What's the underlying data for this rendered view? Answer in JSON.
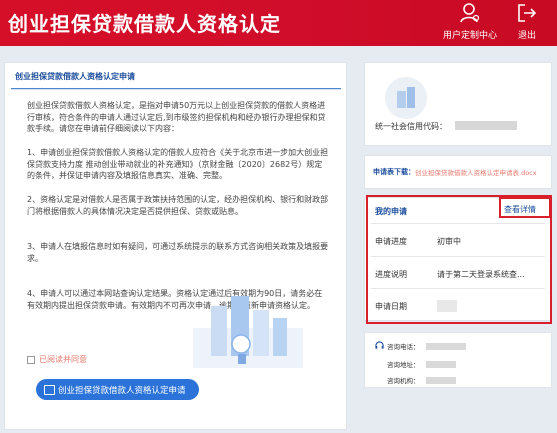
{
  "header": {
    "title": "创业担保贷款借款人资格认定",
    "user_center": "用户定制中心",
    "exit": "退出",
    "color": "#d60f28"
  },
  "left": {
    "title": "创业担保贷款借款人资格认定申请",
    "p1": "创业担保贷款借款人资格认定，是指对申请50万元以上创业担保贷款的借款人资格进行审核，符合条件的申请人通过认定后,到市级签约担保机构和经办银行办理担保和贷款手续。请您在申请前仔细阅读以下内容：",
    "p2": "1、申请创业担保贷款借款人资格认定的借款人应符合《关于北京市进一步加大创业担保贷款支持力度 推动创业带动就业的补充通知》（京财金融〔2020〕2682号）规定的条件，并保证申请内容及填报信息真实、准确、完整。",
    "p3": "2、资格认定是对借款人是否属于政策扶持范围的认定，经办担保机构、银行和财政部门将根据借款人的具体情况决定是否提供担保、贷款或贴息。",
    "p4": "3、申请人在填报信息时如有疑问，可通过系统提示的联系方式咨询相关政策及填报要求。",
    "p5": "4、申请人可以通过本网站查询认定结果。资格认定通过后有效期为90日，请务必在有效期内提出担保贷款申请。有效期内不可再次申请，逾期可重新申请资格认定。",
    "agree_label": "已阅读并同意",
    "apply_button": "创业担保贷款借款人资格认定申请"
  },
  "company": {
    "code_label": "统一社会信用代码："
  },
  "download": {
    "label": "申请表下载：",
    "link": "创业担保贷款借款人资格认定申请表.docx"
  },
  "application": {
    "title": "我的申请",
    "detail": "查看详情",
    "progress_label": "申请进度",
    "progress_value": "初审中",
    "desc_label": "进度说明",
    "desc_value": "请于第二天登录系统查...",
    "date_label": "申请日期"
  },
  "contact": {
    "phone": "咨询电话：",
    "address": "咨询地址：",
    "org": "咨询机构："
  }
}
